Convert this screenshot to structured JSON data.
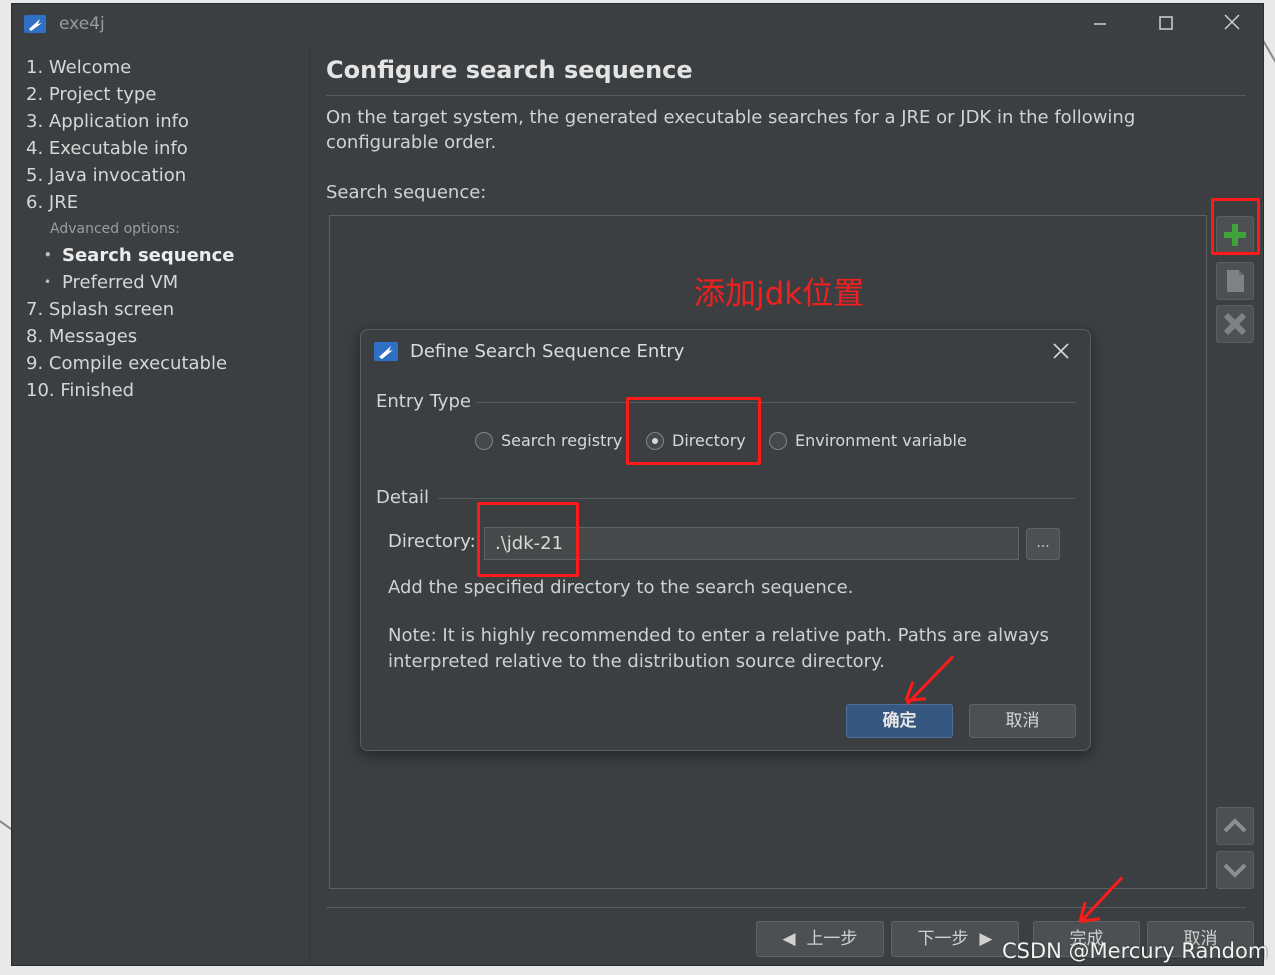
{
  "window": {
    "title": "exe4j"
  },
  "steps": [
    "1. Welcome",
    "2. Project type",
    "3. Application info",
    "4. Executable info",
    "5. Java invocation",
    "6. JRE",
    "Advanced options:",
    "Search sequence",
    "Preferred VM",
    "7. Splash screen",
    "8. Messages",
    "9. Compile executable",
    "10. Finished"
  ],
  "main": {
    "heading": "Configure search sequence",
    "description": "On the target system, the generated executable searches for a JRE or JDK in the following configurable order.",
    "sequence_label": "Search sequence:",
    "annotation": "添加jdk位置"
  },
  "dialog": {
    "title": "Define Search Sequence Entry",
    "entry_type_label": "Entry Type",
    "radio_search_registry": "Search registry",
    "radio_directory": "Directory",
    "radio_env_var": "Environment variable",
    "detail_label": "Detail",
    "directory_label": "Directory:",
    "directory_value": ".\\jdk-21",
    "browse_label": "...",
    "help_text": "Add the specified directory to the search sequence.",
    "note_line1": "Note: It is highly recommended to enter a relative path. Paths are always",
    "note_line2": "interpreted relative to the distribution source directory.",
    "ok_label": "确定",
    "cancel_label": "取消"
  },
  "footer": {
    "back_label": "上一步",
    "next_label": "下一步",
    "finish_label": "完成",
    "cancel_label": "取消"
  },
  "watermark": "CSDN @Mercury Random",
  "colors": {
    "accent": "#365880",
    "annotation_red": "#ff1a1a",
    "add_green": "#3fa33a"
  }
}
